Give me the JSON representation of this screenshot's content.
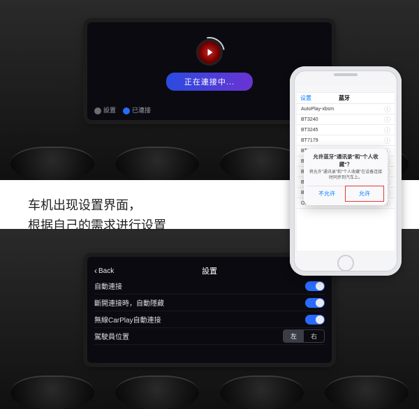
{
  "screen1": {
    "status_text": "正在連接中...",
    "footer": {
      "settings": "設置",
      "connected": "已連接"
    }
  },
  "caption": {
    "line1": "车机出现设置界面，",
    "line2": "根据自己的需求进行设置"
  },
  "phone": {
    "status_time": "",
    "nav_back": "设置",
    "nav_title": "蓝牙",
    "rows": [
      {
        "label": "AutoPlay-xbsm",
        "info": "ⓘ"
      },
      {
        "label": "BT3240",
        "info": "ⓘ"
      },
      {
        "label": "BT3245",
        "info": "ⓘ"
      },
      {
        "label": "BT7179",
        "info": "ⓘ"
      },
      {
        "label": "BT8",
        "info": "ⓘ"
      },
      {
        "label": "BT9",
        "info": "ⓘ"
      },
      {
        "label": "BT8099",
        "info": "ⓘ"
      },
      {
        "label": "BT9883",
        "info": "ⓘ"
      },
      {
        "label": "BT7039",
        "info": "ⓘ"
      },
      {
        "label": "OPPO A7n",
        "info": "ⓘ"
      }
    ],
    "alert": {
      "title": "允许蓝牙\"通讯录\"和\"个人收藏\"？",
      "msg": "将允许\"通讯录\"和\"个人收藏\"在设备连接时同步到汽车上。",
      "cancel": "不允许",
      "allow": "允许"
    }
  },
  "screen2": {
    "back": "Back",
    "title": "設置",
    "rows": [
      {
        "label": "自動連接",
        "type": "toggle",
        "value": true
      },
      {
        "label": "斷開連接時，自動隱藏",
        "type": "toggle",
        "value": true
      },
      {
        "label": "無線CarPlay自動連接",
        "type": "toggle",
        "value": true
      },
      {
        "label": "駕駛員位置",
        "type": "seg",
        "options": [
          "左",
          "右"
        ],
        "selected": 0
      }
    ]
  }
}
